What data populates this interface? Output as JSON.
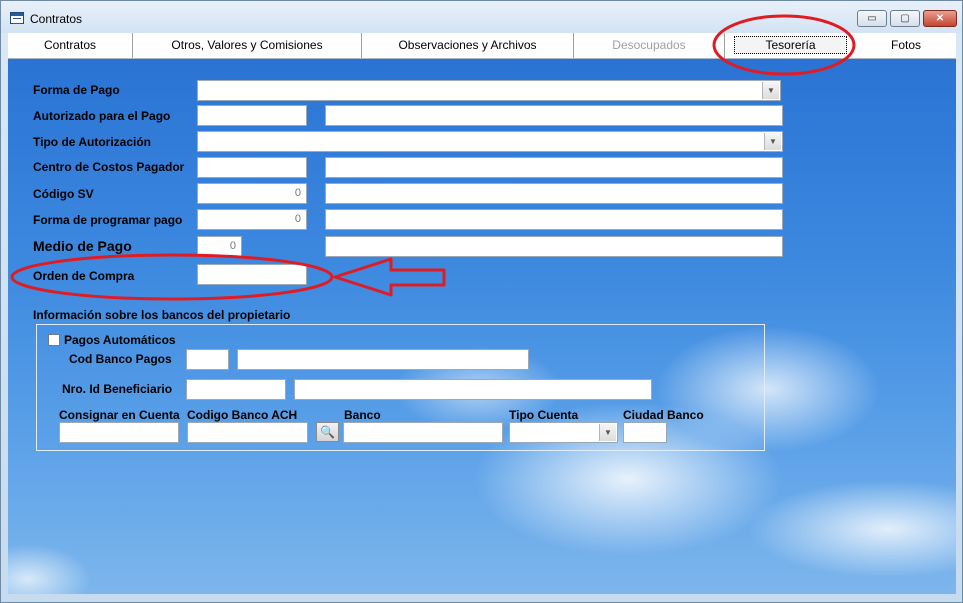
{
  "window": {
    "title": "Contratos",
    "icon": "table-icon"
  },
  "titlebar_buttons": {
    "minimize": "▭",
    "maximize": "▢",
    "close": "✕"
  },
  "tabs": [
    {
      "label": "Contratos"
    },
    {
      "label": "Otros, Valores y Comisiones"
    },
    {
      "label": "Observaciones y Archivos"
    },
    {
      "label": "Desocupados"
    },
    {
      "label": "Tesorería"
    },
    {
      "label": "Fotos"
    }
  ],
  "form": {
    "forma_pago": {
      "label": "Forma de Pago",
      "value": ""
    },
    "autorizado": {
      "label": "Autorizado para el Pago",
      "code": "",
      "name": ""
    },
    "tipo_autorizacion": {
      "label": "Tipo de Autorización",
      "value": ""
    },
    "centro_costos": {
      "label": "Centro de Costos Pagador",
      "code": "",
      "name": ""
    },
    "codigo_sv": {
      "label": "Código SV",
      "code": "0",
      "name": ""
    },
    "forma_programar": {
      "label": "Forma de programar pago",
      "code": "0",
      "name": ""
    },
    "medio_pago": {
      "label": "Medio de Pago",
      "code": "0",
      "name": ""
    },
    "orden_compra": {
      "label": "Orden de Compra",
      "value": ""
    }
  },
  "bancos": {
    "section_label": "Información sobre los bancos del propietario",
    "pagos_automaticos": {
      "label": "Pagos Automáticos",
      "checked": false
    },
    "cod_banco_pagos": {
      "label": "Cod Banco Pagos",
      "code": "",
      "name": ""
    },
    "nro_id_beneficiario": {
      "label": "Nro. Id Beneficiario",
      "code": "",
      "name": ""
    },
    "consignar": {
      "label": "Consignar en Cuenta",
      "value": ""
    },
    "codigo_ach": {
      "label": "Codigo Banco ACH",
      "value": ""
    },
    "search_icon": "binoculars-icon",
    "search_glyph": "🔍",
    "banco": {
      "label": "Banco",
      "value": ""
    },
    "tipo_cuenta": {
      "label": "Tipo Cuenta",
      "value": ""
    },
    "ciudad_banco": {
      "label": "Ciudad Banco",
      "value": ""
    }
  },
  "colors": {
    "annotation": "#e01b22",
    "background_sky": "#3e8ae0"
  }
}
